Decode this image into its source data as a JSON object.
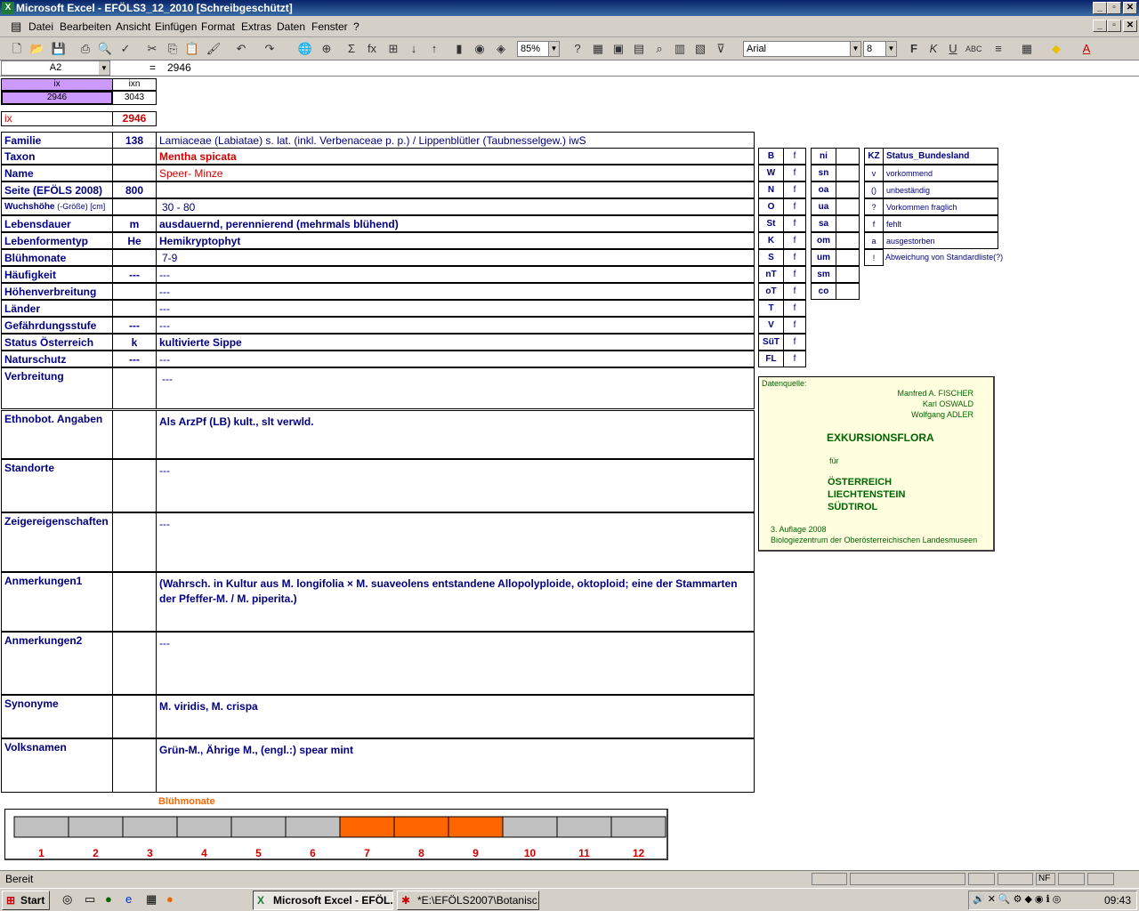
{
  "window": {
    "title": "Microsoft Excel - EFÖLS3_12_2010  [Schreibgeschützt]"
  },
  "menu": [
    "Datei",
    "Bearbeiten",
    "Ansicht",
    "Einfügen",
    "Format",
    "Extras",
    "Daten",
    "Fenster",
    "?"
  ],
  "toolbar": {
    "zoom": "85%",
    "font": "Arial",
    "size": "8"
  },
  "formula": {
    "namebox": "A2",
    "eq": "=",
    "value": "2946"
  },
  "index": {
    "ix_header": "ix",
    "ixn_header": "ixn",
    "ix_value": "2946",
    "ixn_value": "3043",
    "ix_label": "ix",
    "ix_big": "2946"
  },
  "rows": [
    {
      "label": "Familie",
      "code": "138",
      "value": "Lamiaceae (Labiatae) s. lat. (inkl. Verbenaceae p. p.)  /  Lippenblütler (Taubnesselgew.) iwS"
    },
    {
      "label": "Taxon",
      "code": "",
      "value": "Mentha spicata"
    },
    {
      "label": "Name",
      "code": "",
      "value": "Speer- Minze"
    },
    {
      "label": "Seite (EFÖLS 2008)",
      "code": "800",
      "value": ""
    },
    {
      "label": "Wuchshöhe",
      "sublabel": "(-Größe) [cm]",
      "code": "",
      "value": "30 - 80"
    },
    {
      "label": "Lebensdauer",
      "code": "m",
      "value": "ausdauernd, perennierend (mehrmals blühend)"
    },
    {
      "label": "Lebenformentyp",
      "code": "He",
      "value": "Hemikryptophyt"
    },
    {
      "label": "Blühmonate",
      "code": "",
      "value": "7-9"
    },
    {
      "label": "Häufigkeit",
      "code": "---",
      "value": "---"
    },
    {
      "label": "Höhenverbreitung",
      "code": "",
      "value": "---"
    },
    {
      "label": "Länder",
      "code": "",
      "value": "---"
    },
    {
      "label": "Gefährdungsstufe",
      "code": "---",
      "value": "---"
    },
    {
      "label": "Status Österreich",
      "code": "k",
      "value": "kultivierte Sippe"
    },
    {
      "label": "Naturschutz",
      "code": "---",
      "value": "---"
    }
  ],
  "big_rows": [
    {
      "label": "Verbreitung",
      "value": "---"
    },
    {
      "label": "Ethnobot. Angaben",
      "value": "Als ArzPf (LB) kult., slt verwld."
    },
    {
      "label": "Standorte",
      "value": "---"
    },
    {
      "label": "Zeigereigenschaften",
      "value": "---"
    },
    {
      "label": "Anmerkungen1",
      "value": "(Wahrsch. in Kultur aus M. longifolia × M. suaveolens entstandene Allopolyploide, oktoploid; eine der Stammarten der Pfeffer-M. / M. piperita.)"
    },
    {
      "label": "Anmerkungen2",
      "value": "---"
    },
    {
      "label": "Synonyme",
      "value": "M. viridis, M. crispa"
    },
    {
      "label": "Volksnamen",
      "value": "Grün-M., Ährige M., (engl.:) spear mint"
    }
  ],
  "regions1": [
    {
      "k": "B",
      "v": "f"
    },
    {
      "k": "W",
      "v": "f"
    },
    {
      "k": "N",
      "v": "f"
    },
    {
      "k": "O",
      "v": "f"
    },
    {
      "k": "St",
      "v": "f"
    },
    {
      "k": "K",
      "v": "f"
    },
    {
      "k": "S",
      "v": "f"
    },
    {
      "k": "nT",
      "v": "f"
    },
    {
      "k": "oT",
      "v": "f"
    },
    {
      "k": "T",
      "v": "f"
    },
    {
      "k": "V",
      "v": "f"
    },
    {
      "k": "SüT",
      "v": "f"
    },
    {
      "k": "FL",
      "v": "f"
    }
  ],
  "regions2": [
    "ni",
    "sn",
    "oa",
    "ua",
    "sa",
    "om",
    "um",
    "sm",
    "co"
  ],
  "legend": {
    "header_k": "KZ",
    "header_v": "Status_Bundesland",
    "items": [
      {
        "k": "v",
        "v": "vorkommend"
      },
      {
        "k": "()",
        "v": "unbeständig"
      },
      {
        "k": "?",
        "v": "Vorkommen fraglich"
      },
      {
        "k": "f",
        "v": "fehlt"
      },
      {
        "k": "a",
        "v": "ausgestorben"
      },
      {
        "k": "!",
        "v": "Abweichung von Standardliste(?)"
      }
    ]
  },
  "source": {
    "label": "Datenquelle:",
    "author1": "Manfred A. FISCHER",
    "author2": "Karl OSWALD",
    "author3": "Wolfgang ADLER",
    "title": "EXKURSIONSFLORA",
    "fuer": "für",
    "c1": "ÖSTERREICH",
    "c2": "LIECHTENSTEIN",
    "c3": "SÜDTIROL",
    "edition": "3. Auflage 2008",
    "publisher": "Biologiezentrum der Oberösterreichischen Landesmuseen"
  },
  "chart_data": {
    "type": "bar",
    "title": "Blühmonate",
    "categories": [
      "1",
      "2",
      "3",
      "4",
      "5",
      "6",
      "7",
      "8",
      "9",
      "10",
      "11",
      "12"
    ],
    "values": [
      0,
      0,
      0,
      0,
      0,
      0,
      1,
      1,
      1,
      0,
      0,
      0
    ],
    "colors": {
      "on": "#ff6600",
      "off": "#c0c0c0"
    }
  },
  "status": {
    "text": "Bereit",
    "nf": "NF"
  },
  "taskbar": {
    "start": "Start",
    "task1": "Microsoft Excel - EFÖL...",
    "task2": "*E:\\EFÖLS2007\\Botanisc...",
    "clock": "09:43"
  }
}
